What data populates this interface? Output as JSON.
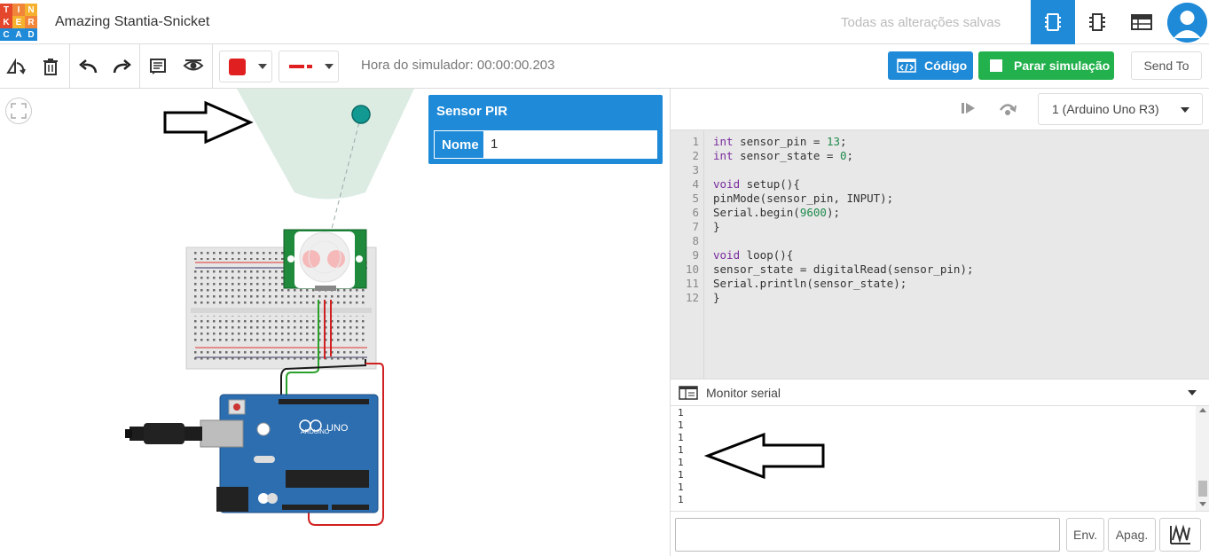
{
  "header": {
    "logo_letters": [
      "T",
      "I",
      "N",
      "K",
      "E",
      "R",
      "C",
      "A",
      "D"
    ],
    "logo_colors": [
      "#e5472c",
      "#f1863a",
      "#f5b12e",
      "#e5472c",
      "#f5b12e",
      "#f1863a",
      "#1f8ad8",
      "#1f8ad8",
      "#1f8ad8"
    ],
    "project_title": "Amazing Stantia-Snicket",
    "save_status": "Todas as alterações salvas",
    "views": [
      "circuit-view-icon",
      "schematic-view-icon",
      "component-list-icon"
    ],
    "avatar": "user-avatar-icon"
  },
  "toolbar": {
    "simulator_time": "Hora do simulador: 00:00:00.203",
    "code_label": "Código",
    "stop_sim_label": "Parar simulação",
    "send_to_label": "Send To",
    "color_swatch": "#e02020",
    "line_color": "#e02020"
  },
  "inspector": {
    "title": "Sensor PIR",
    "name_label": "Nome",
    "name_value": "1"
  },
  "code_panel": {
    "board_select": "1 (Arduino Uno R3)",
    "line_numbers": [
      "1",
      "2",
      "3",
      "4",
      "5",
      "6",
      "7",
      "8",
      "9",
      "10",
      "11",
      "12"
    ],
    "code_lines": [
      "int sensor_pin = 13;",
      "int sensor_state = 0;",
      "",
      "void setup(){",
      "pinMode(sensor_pin, INPUT);",
      "Serial.begin(9600);",
      "}",
      "",
      "void loop(){",
      "sensor_state = digitalRead(sensor_pin);",
      "Serial.println(sensor_state);",
      "}"
    ]
  },
  "serial_monitor": {
    "title": "Monitor serial",
    "output_lines": [
      "1",
      "1",
      "1",
      "1",
      "1",
      "1",
      "1",
      "1"
    ],
    "send_label": "Env.",
    "clear_label": "Apag."
  },
  "colors": {
    "accent": "#1f8ad8",
    "go_green": "#22b14c",
    "breadboard": "#e8e8e8",
    "arduino": "#2d6eb0",
    "pir_board": "#1f8a3c"
  }
}
